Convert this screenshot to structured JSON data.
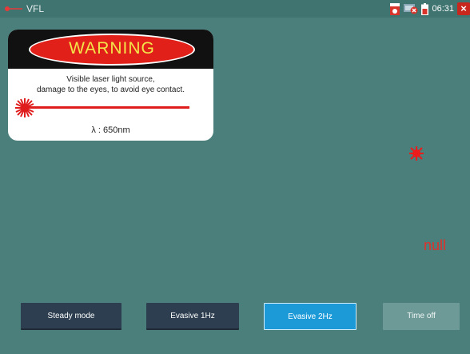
{
  "window": {
    "title": "VFL",
    "app_icon": "laser-pen-icon"
  },
  "statusbar": {
    "time": "06:31",
    "icons": [
      "battery-alert-icon",
      "network-error-icon",
      "battery-icon",
      "close-icon"
    ],
    "close_label": "×"
  },
  "warning": {
    "header": "WARNING",
    "line1": "Visible laser light source,",
    "line2": "damage to the eyes, to avoid eye contact.",
    "wavelength": "λ : 650nm"
  },
  "indicator": {
    "icon": "laser-burst-icon",
    "status": "null"
  },
  "modes": {
    "steady": "Steady mode",
    "hz1": "Evasive 1Hz",
    "hz2": "Evasive 2Hz",
    "timeoff": "Time off",
    "selected": "Evasive 2Hz"
  },
  "colors": {
    "background": "#4a7f7b",
    "selected_button": "#1c9ad8",
    "button": "#2c3e4f",
    "warning_red": "#e2201a",
    "laser_red": "#e01d1d"
  }
}
